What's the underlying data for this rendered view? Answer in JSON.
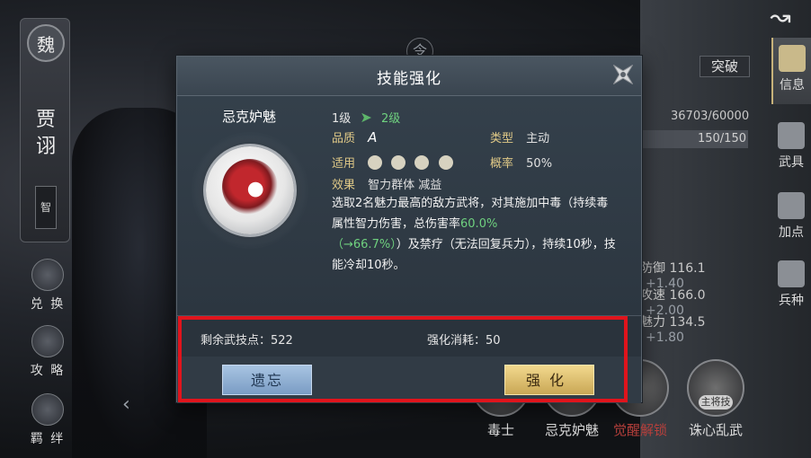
{
  "background": {
    "plaque": {
      "seal": "魏",
      "name": "贾诩",
      "tag": "智"
    },
    "left_menu": [
      {
        "label": "兑 换",
        "icon": "exchange-icon"
      },
      {
        "label": "攻 略",
        "icon": "guide-icon"
      },
      {
        "label": "羁 绊",
        "icon": "bond-icon"
      }
    ],
    "ling": "令",
    "right_tabs": [
      {
        "label": "信息",
        "icon": "scroll-icon",
        "active": true
      },
      {
        "label": "武具",
        "icon": "weapon-icon",
        "active": false
      },
      {
        "label": "加点",
        "icon": "points-icon",
        "active": false
      },
      {
        "label": "兵种",
        "icon": "helmet-icon",
        "active": false
      }
    ],
    "breakthrough_label": "突破",
    "xp_text": "36703/60000",
    "hp_text": "150/150",
    "stats": [
      {
        "name": "防御",
        "value": "116.1",
        "plus": "+1.40"
      },
      {
        "name": "攻速",
        "value": "166.0",
        "plus": "+2.00"
      },
      {
        "name": "魅力",
        "value": "134.5",
        "plus": "+1.80"
      }
    ],
    "bottom_skills": [
      {
        "name": "毒士",
        "style": "normal"
      },
      {
        "name": "忌克妒魅",
        "style": "normal"
      },
      {
        "name": "觉醒解锁",
        "style": "red"
      },
      {
        "name": "诛心乱武",
        "style": "normal"
      }
    ],
    "wujiang_tag": "主将技"
  },
  "modal": {
    "title": "技能强化",
    "skill_name": "忌克妒魅",
    "level_from": "1级",
    "level_to": "2级",
    "quality_label": "品质",
    "quality_value": "A",
    "type_label": "类型",
    "type_value": "主动",
    "applicable_label": "适用",
    "applicable_icons": [
      "shield-icon",
      "bow-icon",
      "spear-icon",
      "horse-icon"
    ],
    "rate_label": "概率",
    "rate_value": "50%",
    "effect_label": "效果",
    "effect_value": "智力群体 减益",
    "description_1": "选取2名魅力最高的敌方武将，对其施加中毒（持续毒属性智力伤害，总伤害率",
    "description_rate": "60.0%",
    "description_rate_new": "（→66.7%）",
    "description_2": "）及禁疗（无法回复兵力），持续10秒，技能冷却10秒。",
    "remaining_points": "剩余武技点：522",
    "enhance_cost": "强化消耗：50",
    "forget_button": "遗忘",
    "enhance_button": "强化"
  },
  "colors": {
    "accent_green": "#6fd17f",
    "label_gold": "#e0c987",
    "highlight_red": "#e0141c",
    "forget_blue": "#8fb0d6",
    "enhance_gold": "#e2c573"
  }
}
